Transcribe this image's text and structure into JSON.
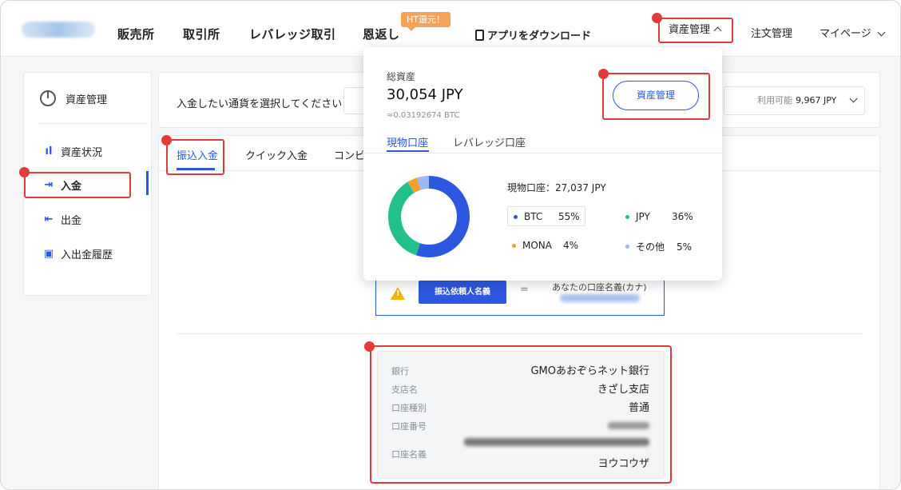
{
  "header": {
    "nav": [
      "販売所",
      "取引所",
      "レバレッジ取引",
      "恩返し"
    ],
    "ht_badge": "HT還元！",
    "app_download": "アプリをダウンロード",
    "asset_mgmt": "資産管理",
    "orders": "注文管理",
    "mypage": "マイページ"
  },
  "sidebar": {
    "title": "資産管理",
    "items": [
      {
        "label": "資産状況",
        "icon": "bar-chart-icon"
      },
      {
        "label": "入金",
        "icon": "deposit-arrow-icon"
      },
      {
        "label": "出金",
        "icon": "withdraw-arrow-icon"
      },
      {
        "label": "入出金履歴",
        "icon": "history-card-icon"
      }
    ]
  },
  "topbar": {
    "select_label": "入金したい通貨を選択してください",
    "available_label": "利用可能",
    "available_value": "9,967 JPY"
  },
  "tabs": [
    "振込入金",
    "クイック入金",
    "コンビ"
  ],
  "notice": {
    "button": "振込依頼人名義",
    "equals": "=",
    "account_kana_label": "あなたの口座名義(カナ)"
  },
  "bank": {
    "rows": [
      {
        "label": "銀行",
        "value": "GMOあおぞらネット銀行"
      },
      {
        "label": "支店名",
        "value": "きざし支店"
      },
      {
        "label": "口座種別",
        "value": "普通"
      },
      {
        "label": "口座番号",
        "value": ""
      },
      {
        "label": "口座名義",
        "value": "ヨウコウザ"
      }
    ]
  },
  "dropdown": {
    "total_label": "総資産",
    "total_value": "30,054 JPY",
    "btc_equiv": "≈0.03192674 BTC",
    "button": "資産管理",
    "tabs": [
      "現物口座",
      "レバレッジ口座"
    ],
    "spot_summary": "現物口座：27,037 JPY"
  },
  "chart_data": {
    "type": "pie",
    "series": [
      {
        "name": "BTC",
        "value": 55,
        "color": "#2c58e0",
        "label": "55%"
      },
      {
        "name": "JPY",
        "value": 36,
        "color": "#22c08a",
        "label": "36%"
      },
      {
        "name": "MONA",
        "value": 4,
        "color": "#f2a12b",
        "label": "4%"
      },
      {
        "name": "その他",
        "value": 5,
        "color": "#9db8f3",
        "label": "5%"
      }
    ]
  },
  "colors": {
    "accent": "#2c58e0",
    "highlight": "#e23b3b"
  }
}
